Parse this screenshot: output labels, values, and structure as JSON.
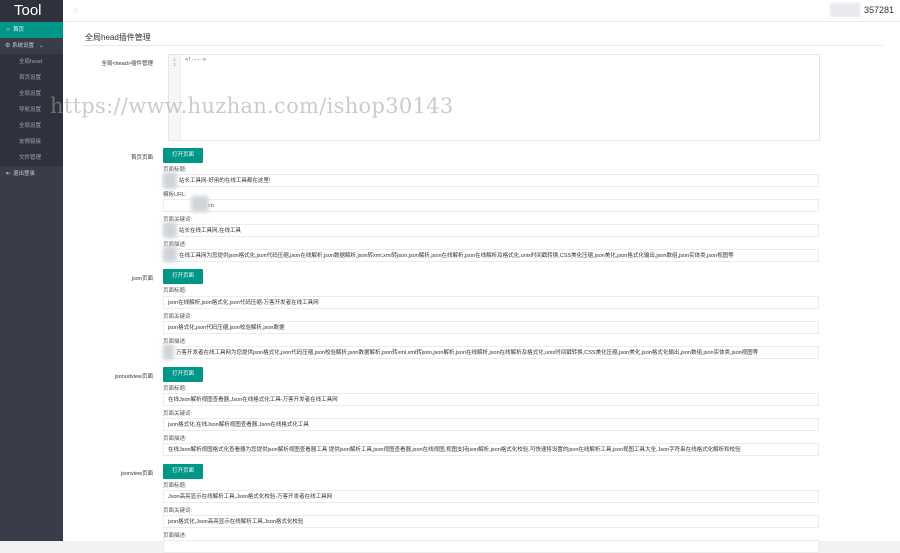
{
  "sidebar": {
    "logo": "Tool",
    "items": [
      {
        "icon": "home-icon",
        "label": "首页",
        "active": true
      },
      {
        "icon": "gear-icon",
        "label": "系统设置",
        "group": true
      },
      {
        "label": "全局head"
      },
      {
        "label": "首页设置"
      },
      {
        "label": "全局设置"
      },
      {
        "label": "导航设置"
      },
      {
        "label": "全局设置"
      },
      {
        "label": "友情链接"
      },
      {
        "label": "文件管理"
      },
      {
        "icon": "logout-icon",
        "label": "退出登录"
      }
    ]
  },
  "topbar": {
    "user_name": "357281"
  },
  "page": {
    "title": "全局head插件管理",
    "editor_label": "全局<head>插件管理",
    "editor_lines": [
      "1",
      "2"
    ],
    "editor_code": "<!---->"
  },
  "watermark": "https://www.huzhan.com/ishop30143",
  "sections": [
    {
      "name": "首页页面",
      "button": "打开页面",
      "fields": [
        {
          "label": "页面标题:",
          "value": "站长工具网-好用的在线工具都在这里!"
        },
        {
          "label": "模板URL:",
          "value": "cn"
        },
        {
          "label": "页面关键词:",
          "value": "站长在线工具网,在线工具"
        },
        {
          "label": "页面描述:",
          "value": "在线工具网为您提供json格式化,json代码压缩,json在线解析,json数据解析,json转xml,xml转json,json解析,json在线解析,json在线解析及格式化,unix时间戳转换,CSS美化压缩,json美化,json格式化输出,json数组,json实体类,json视图等"
        }
      ]
    },
    {
      "name": "json页面",
      "button": "打开页面",
      "fields": [
        {
          "label": "页面标题:",
          "value": "json在线解析,json格式化,json代码压缩-万客开发者在线工具网"
        },
        {
          "label": "页面关键词:",
          "value": "json格式化,json代码压缩,json校验解析,json数据"
        },
        {
          "label": "页面描述:",
          "value": "万客开发者在线工具网为您提供json格式化,json代码压缩,json校验解析,json数据解析,json转xml,xml转json,json解析,json在线解析,json在线解析及格式化,unix时间戳转换,CSS美化压缩,json美化,json格式化输出,json数组,json实体类,json视图等"
        }
      ]
    },
    {
      "name": "jsonudview页面",
      "button": "打开页面",
      "fields": [
        {
          "label": "页面标题:",
          "value": "在线Json解析视图查看器,Json在线格式化工具-万客开发者在线工具网"
        },
        {
          "label": "页面关键词:",
          "value": "json格式化,在线Json解析视图查看器,Json在线格式化工具"
        },
        {
          "label": "页面描述:",
          "value": "在线Json解析视图格式化查看器为您提供json解析视图查看器工具 提供json解析工具,json视图查看器,json在线视图,视图支持json解析,json格式化校验,可快速将设置的json在线解析工具,json视图工具大全,Json字符串在线格式化解析和校验"
        }
      ]
    },
    {
      "name": "jsonview页面",
      "button": "打开页面",
      "fields": [
        {
          "label": "页面标题:",
          "value": "Json高亮显示在线解析工具,Json格式化校验-万客开发者在线工具网"
        },
        {
          "label": "页面关键词:",
          "value": "json格式化,Json高亮显示在线解析工具,Json格式化校验"
        },
        {
          "label": "页面描述:",
          "value": ""
        }
      ]
    }
  ]
}
